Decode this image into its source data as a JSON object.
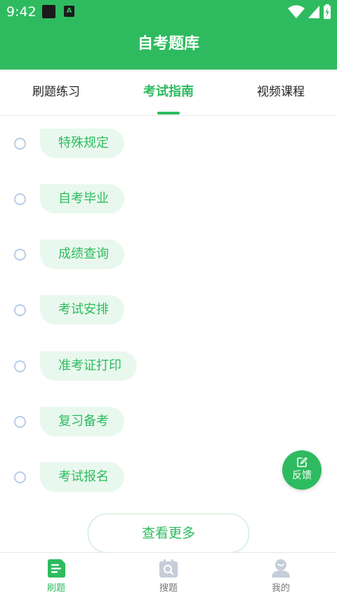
{
  "status_bar": {
    "time": "9:42",
    "notification_letter": "A"
  },
  "header": {
    "title": "自考题库"
  },
  "tabs": [
    {
      "label": "刷题练习",
      "active": false
    },
    {
      "label": "考试指南",
      "active": true
    },
    {
      "label": "视频课程",
      "active": false
    }
  ],
  "guide_items": [
    {
      "label": "特殊规定"
    },
    {
      "label": "自考毕业"
    },
    {
      "label": "成绩查询"
    },
    {
      "label": "考试安排"
    },
    {
      "label": "准考证打印"
    },
    {
      "label": "复习备考"
    },
    {
      "label": "考试报名"
    }
  ],
  "more_button": {
    "label": "查看更多"
  },
  "feedback": {
    "label": "反馈",
    "icon": "edit-icon"
  },
  "bottom_nav": [
    {
      "label": "刷题",
      "icon": "document-icon",
      "active": true
    },
    {
      "label": "搜题",
      "icon": "search-calendar-icon",
      "active": false
    },
    {
      "label": "我的",
      "icon": "user-icon",
      "active": false
    }
  ],
  "colors": {
    "primary": "#2ebb5f",
    "pill_bg": "#e9f8ee",
    "radio_border": "#b9cde6",
    "inactive_icon": "#c5cdd9"
  }
}
